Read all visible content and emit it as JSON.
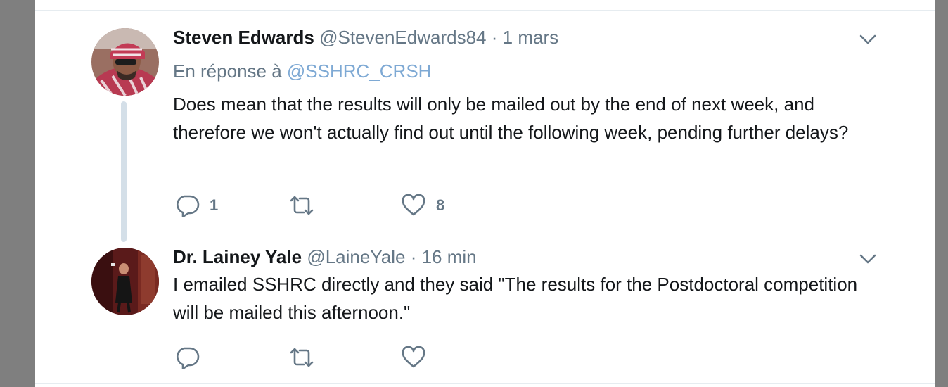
{
  "tweets": [
    {
      "name": "Steven Edwards",
      "handle": "@StevenEdwards84",
      "separator": "·",
      "time": "1 mars",
      "reply_prefix": "En réponse à",
      "reply_mention": "@SSHRC_CRSH",
      "text": "Does mean that the results will only be mailed out by the end of next week, and therefore we won't actually find out until the following week, pending further delays?",
      "reply_count": "1",
      "retweet_count": "",
      "like_count": "8",
      "icons": [
        "reply-icon",
        "retweet-icon",
        "like-icon",
        "chevron-down-icon"
      ]
    },
    {
      "name": "Dr. Lainey Yale",
      "handle": "@LaineYale",
      "separator": "·",
      "time": "16 min",
      "text": "I emailed SSHRC directly and they said \"The results for the Postdoctoral competition will be mailed this afternoon.\"",
      "reply_count": "",
      "retweet_count": "",
      "like_count": "",
      "icons": [
        "reply-icon",
        "retweet-icon",
        "like-icon",
        "chevron-down-icon"
      ]
    }
  ],
  "colors": {
    "text_primary": "#14171a",
    "text_secondary": "#657786",
    "mention": "#7ea9d4",
    "thread_line": "#d4dfe8",
    "background_outside": "#7f7f7f"
  }
}
